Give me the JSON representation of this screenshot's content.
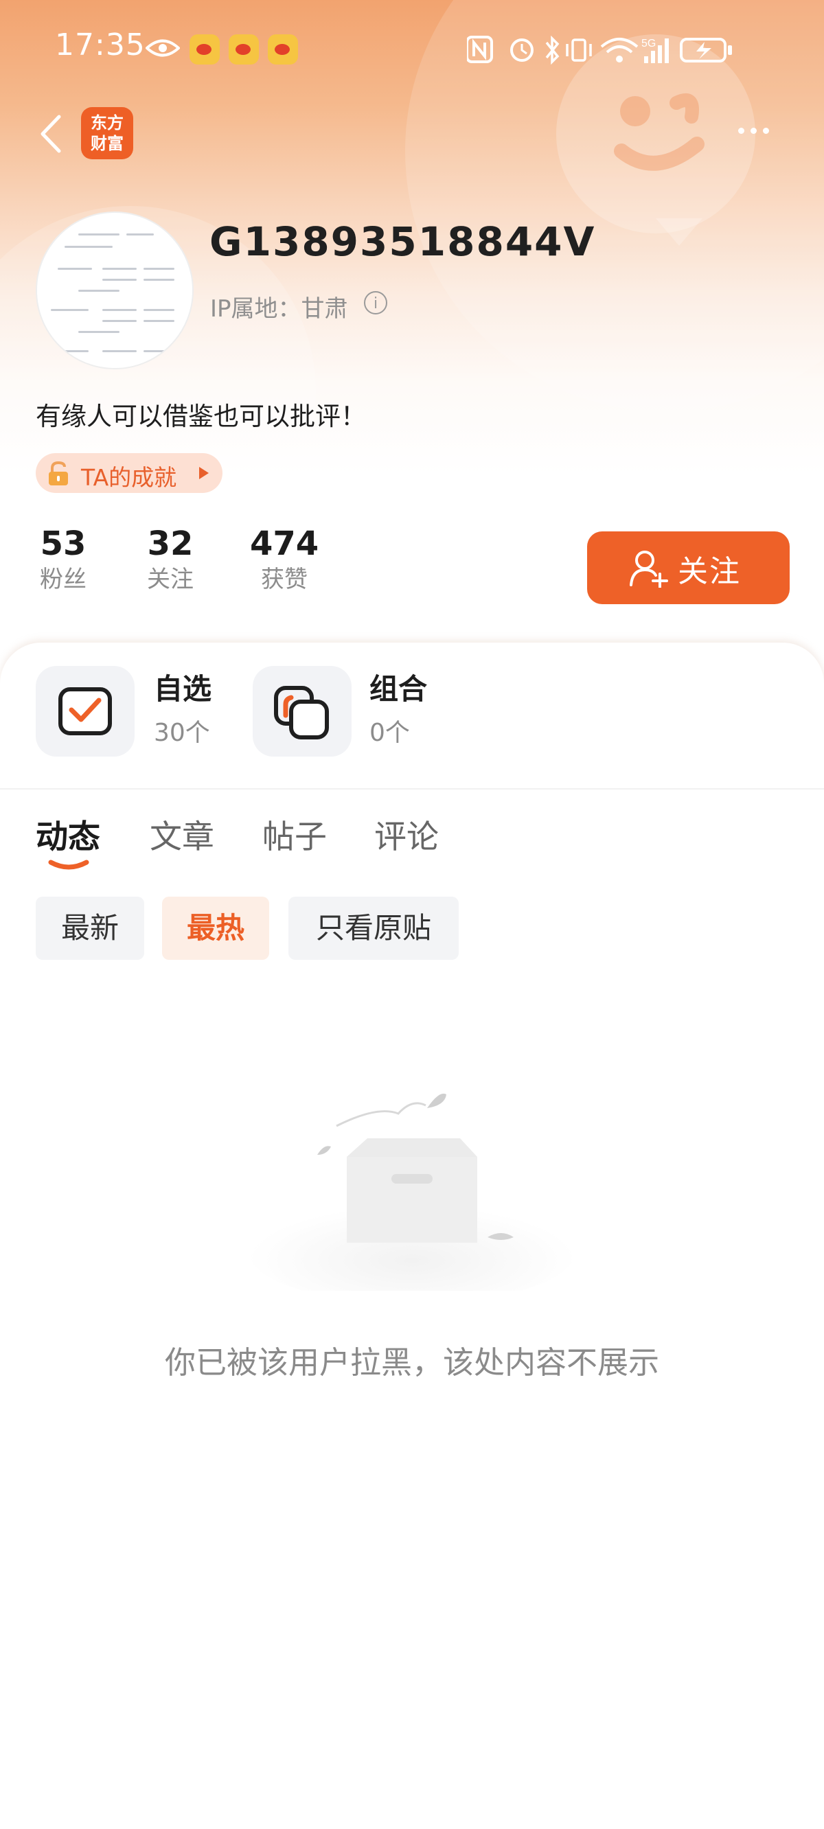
{
  "status_bar": {
    "time": "17:35",
    "network": "5G"
  },
  "nav": {
    "logo_line1": "东方",
    "logo_line2": "财富"
  },
  "profile": {
    "username": "G13893518844V",
    "ip_location": "IP属地：甘肃",
    "bio": "有缘人可以借鉴也可以批评！",
    "achievement_label": "TA的成就"
  },
  "stats": [
    {
      "value": "53",
      "label": "粉丝"
    },
    {
      "value": "32",
      "label": "关注"
    },
    {
      "value": "474",
      "label": "获赞"
    }
  ],
  "follow_button": {
    "label": "关注"
  },
  "tools": [
    {
      "title": "自选",
      "count": "30个"
    },
    {
      "title": "组合",
      "count": "0个"
    }
  ],
  "tabs": [
    {
      "label": "动态",
      "active": true
    },
    {
      "label": "文章",
      "active": false
    },
    {
      "label": "帖子",
      "active": false
    },
    {
      "label": "评论",
      "active": false
    }
  ],
  "filters": [
    {
      "label": "最新",
      "active": false
    },
    {
      "label": "最热",
      "active": true
    },
    {
      "label": "只看原贴",
      "active": false
    }
  ],
  "empty_state": {
    "message": "你已被该用户拉黑，该处内容不展示"
  },
  "colors": {
    "accent": "#EE6128",
    "header_top": "#F2A36F",
    "logo_bg": "#EE5F26"
  }
}
